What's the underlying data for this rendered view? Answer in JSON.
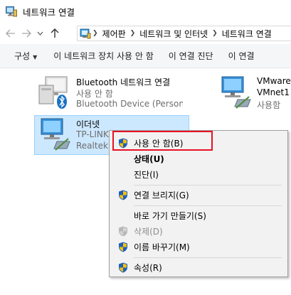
{
  "window": {
    "title": "네트워크 연결"
  },
  "nav": {
    "back_icon": "back-arrow",
    "forward_icon": "forward-arrow",
    "recent_icon": "chevron-down",
    "up_icon": "up-arrow",
    "breadcrumbs": [
      "제어판",
      "네트워크 및 인터넷",
      "네트워크 연결"
    ]
  },
  "toolbar": {
    "organize": "구성",
    "disable_device": "이 네트워크 장치 사용 안 함",
    "diagnose": "이 연결 진단",
    "rename": "이 연결"
  },
  "connections": [
    {
      "name": "Bluetooth 네트워크 연결",
      "status": "사용 안 함",
      "device": "Bluetooth Device (Persona..."
    },
    {
      "name": "VMware",
      "status": "VMnet1",
      "device": "사용함"
    },
    {
      "name": "이더넷",
      "status": "TP-LINK",
      "device": "Realtek P"
    }
  ],
  "context_menu": {
    "items": [
      {
        "label": "사용 안 함(B)",
        "shield": true,
        "style": "normal"
      },
      {
        "label": "상태(U)",
        "shield": false,
        "style": "bold"
      },
      {
        "label": "진단(I)",
        "shield": false,
        "style": "normal"
      },
      {
        "label": "연결 브리지(G)",
        "shield": true,
        "style": "normal"
      },
      {
        "label": "바로 가기 만들기(S)",
        "shield": false,
        "style": "normal"
      },
      {
        "label": "삭제(D)",
        "shield": true,
        "style": "disabled"
      },
      {
        "label": "이름 바꾸기(M)",
        "shield": true,
        "style": "normal"
      },
      {
        "label": "속성(R)",
        "shield": true,
        "style": "normal"
      }
    ]
  },
  "colors": {
    "selection_bg": "#cce8ff",
    "highlight_border": "#e81123",
    "shield_blue": "#1f5fbf",
    "shield_yellow": "#f5c400"
  }
}
